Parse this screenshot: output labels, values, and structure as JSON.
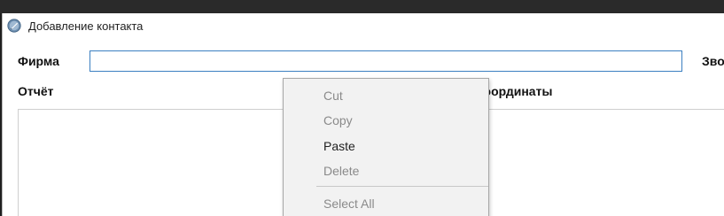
{
  "window": {
    "title": "Добавление контакта",
    "icon": "feather-pen-icon"
  },
  "form": {
    "firm_label": "Фирма",
    "firm_value": "",
    "calls_label": "Звонки",
    "report_label": "Отчёт",
    "coords_label": "Координаты",
    "report_value": ""
  },
  "context_menu": {
    "items": [
      {
        "label": "Cut",
        "enabled": false
      },
      {
        "label": "Copy",
        "enabled": false
      },
      {
        "label": "Paste",
        "enabled": true
      },
      {
        "label": "Delete",
        "enabled": false
      },
      {
        "label": "Select All",
        "enabled": false
      }
    ]
  },
  "colors": {
    "input_focus_border": "#3b7fc1",
    "menu_background": "#f2f2f2",
    "disabled_text": "#8a8a8a",
    "enabled_text": "#222222"
  }
}
